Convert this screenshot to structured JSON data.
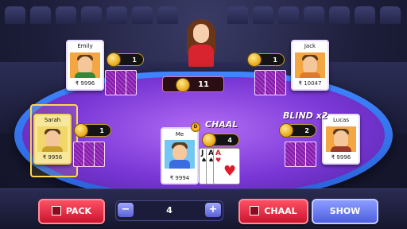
{
  "players": {
    "emily": {
      "name": "Emily",
      "money": "₹ 9996",
      "bet": "1"
    },
    "jack": {
      "name": "Jack",
      "money": "₹ 10047",
      "bet": "1"
    },
    "sarah": {
      "name": "Sarah",
      "money": "₹ 9956",
      "bet": "1"
    },
    "lucas": {
      "name": "Lucas",
      "money": "₹ 9996",
      "bet": "2"
    },
    "me": {
      "name": "Me",
      "money": "₹ 9994",
      "bet": "4"
    }
  },
  "pot": "11",
  "dealer_badge": "D",
  "labels": {
    "chaal": "CHAAL",
    "blind": "BLIND x2"
  },
  "my_cards": [
    {
      "rank": "J",
      "suit": "♠",
      "color": "black"
    },
    {
      "rank": "A",
      "suit": "♠",
      "color": "black"
    },
    {
      "rank": "A",
      "suit": "♥",
      "color": "red"
    }
  ],
  "controls": {
    "pack_label": "PACK",
    "chaal_label": "CHAAL",
    "show_label": "SHOW",
    "stepper_value": "4",
    "minus": "−",
    "plus": "+"
  },
  "icons": {
    "coin": "coin-icon",
    "card_back": "card-back-icon",
    "checkbox": "checkbox-icon"
  }
}
